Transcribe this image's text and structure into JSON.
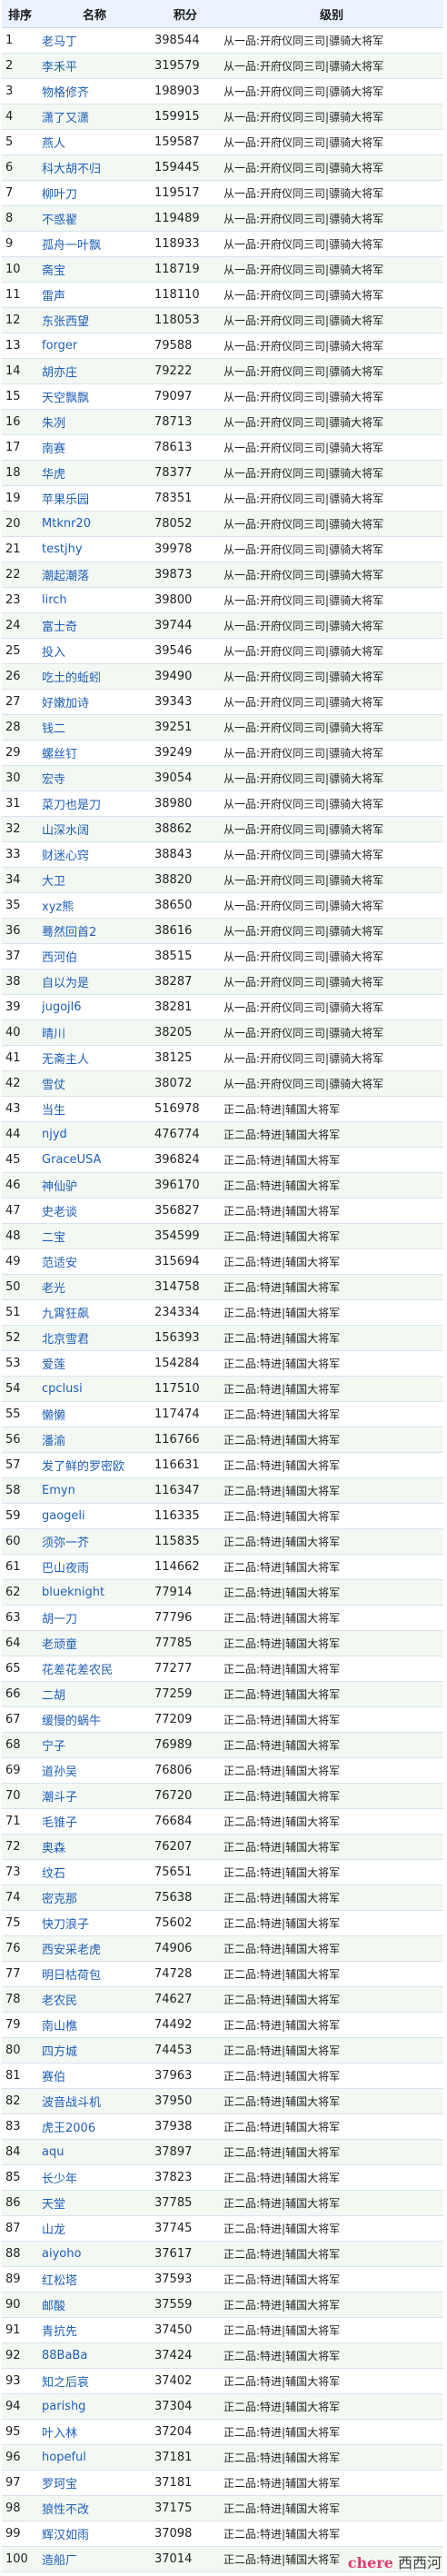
{
  "headers": {
    "rank": "排序",
    "name": "名称",
    "score": "积分",
    "level": "级别"
  },
  "level_texts": {
    "a": "从一品:开府仪同三司|骠骑大将军",
    "b": "正二品:特进|辅国大将军"
  },
  "rows": [
    {
      "rank": "1",
      "name": "老马丁",
      "score": "398544",
      "level": "从一品:开府仪同三司|骠骑大将军"
    },
    {
      "rank": "2",
      "name": "李禾平",
      "score": "319579",
      "level": "从一品:开府仪同三司|骠骑大将军"
    },
    {
      "rank": "3",
      "name": "物格修齐",
      "score": "198903",
      "level": "从一品:开府仪同三司|骠骑大将军"
    },
    {
      "rank": "4",
      "name": "潇了又潇",
      "score": "159915",
      "level": "从一品:开府仪同三司|骠骑大将军"
    },
    {
      "rank": "5",
      "name": "燕人",
      "score": "159587",
      "level": "从一品:开府仪同三司|骠骑大将军"
    },
    {
      "rank": "6",
      "name": "科大胡不归",
      "score": "159445",
      "level": "从一品:开府仪同三司|骠骑大将军"
    },
    {
      "rank": "7",
      "name": "柳叶刀",
      "score": "119517",
      "level": "从一品:开府仪同三司|骠骑大将军"
    },
    {
      "rank": "8",
      "name": "不惑翟",
      "score": "119489",
      "level": "从一品:开府仪同三司|骠骑大将军"
    },
    {
      "rank": "9",
      "name": "孤舟一叶飘",
      "score": "118933",
      "level": "从一品:开府仪同三司|骠骑大将军"
    },
    {
      "rank": "10",
      "name": "斋宝",
      "score": "118719",
      "level": "从一品:开府仪同三司|骠骑大将军"
    },
    {
      "rank": "11",
      "name": "雷声",
      "score": "118110",
      "level": "从一品:开府仪同三司|骠骑大将军"
    },
    {
      "rank": "12",
      "name": "东张西望",
      "score": "118053",
      "level": "从一品:开府仪同三司|骠骑大将军"
    },
    {
      "rank": "13",
      "name": "forger",
      "score": "79588",
      "level": "从一品:开府仪同三司|骠骑大将军"
    },
    {
      "rank": "14",
      "name": "胡亦庄",
      "score": "79222",
      "level": "从一品:开府仪同三司|骠骑大将军"
    },
    {
      "rank": "15",
      "name": "天空飘飘",
      "score": "79097",
      "level": "从一品:开府仪同三司|骠骑大将军"
    },
    {
      "rank": "16",
      "name": "朱冽",
      "score": "78713",
      "level": "从一品:开府仪同三司|骠骑大将军"
    },
    {
      "rank": "17",
      "name": "南赛",
      "score": "78613",
      "level": "从一品:开府仪同三司|骠骑大将军"
    },
    {
      "rank": "18",
      "name": "华虎",
      "score": "78377",
      "level": "从一品:开府仪同三司|骠骑大将军"
    },
    {
      "rank": "19",
      "name": "苹果乐园",
      "score": "78351",
      "level": "从一品:开府仪同三司|骠骑大将军"
    },
    {
      "rank": "20",
      "name": "Mtknr20",
      "score": "78052",
      "level": "从一品:开府仪同三司|骠骑大将军"
    },
    {
      "rank": "21",
      "name": "testjhy",
      "score": "39978",
      "level": "从一品:开府仪同三司|骠骑大将军"
    },
    {
      "rank": "22",
      "name": "潮起潮落",
      "score": "39873",
      "level": "从一品:开府仪同三司|骠骑大将军"
    },
    {
      "rank": "23",
      "name": "lirch",
      "score": "39800",
      "level": "从一品:开府仪同三司|骠骑大将军"
    },
    {
      "rank": "24",
      "name": "富士奇",
      "score": "39744",
      "level": "从一品:开府仪同三司|骠骑大将军"
    },
    {
      "rank": "25",
      "name": "投入",
      "score": "39546",
      "level": "从一品:开府仪同三司|骠骑大将军"
    },
    {
      "rank": "26",
      "name": "吃土的蚯蚓",
      "score": "39490",
      "level": "从一品:开府仪同三司|骠骑大将军"
    },
    {
      "rank": "27",
      "name": "好嫩加诗",
      "score": "39343",
      "level": "从一品:开府仪同三司|骠骑大将军"
    },
    {
      "rank": "28",
      "name": "钱二",
      "score": "39251",
      "level": "从一品:开府仪同三司|骠骑大将军"
    },
    {
      "rank": "29",
      "name": "螺丝钉",
      "score": "39249",
      "level": "从一品:开府仪同三司|骠骑大将军"
    },
    {
      "rank": "30",
      "name": "宏寺",
      "score": "39054",
      "level": "从一品:开府仪同三司|骠骑大将军"
    },
    {
      "rank": "31",
      "name": "菜刀也是刀",
      "score": "38980",
      "level": "从一品:开府仪同三司|骠骑大将军"
    },
    {
      "rank": "32",
      "name": "山深水阔",
      "score": "38862",
      "level": "从一品:开府仪同三司|骠骑大将军"
    },
    {
      "rank": "33",
      "name": "财迷心窍",
      "score": "38843",
      "level": "从一品:开府仪同三司|骠骑大将军"
    },
    {
      "rank": "34",
      "name": "大卫",
      "score": "38820",
      "level": "从一品:开府仪同三司|骠骑大将军"
    },
    {
      "rank": "35",
      "name": "xyz熊",
      "score": "38650",
      "level": "从一品:开府仪同三司|骠骑大将军"
    },
    {
      "rank": "36",
      "name": "蓦然回首2",
      "score": "38616",
      "level": "从一品:开府仪同三司|骠骑大将军"
    },
    {
      "rank": "37",
      "name": "西河伯",
      "score": "38515",
      "level": "从一品:开府仪同三司|骠骑大将军"
    },
    {
      "rank": "38",
      "name": "自以为是",
      "score": "38287",
      "level": "从一品:开府仪同三司|骠骑大将军"
    },
    {
      "rank": "39",
      "name": "jugojl6",
      "score": "38281",
      "level": "从一品:开府仪同三司|骠骑大将军"
    },
    {
      "rank": "40",
      "name": "晴川",
      "score": "38205",
      "level": "从一品:开府仪同三司|骠骑大将军"
    },
    {
      "rank": "41",
      "name": "无斋主人",
      "score": "38125",
      "level": "从一品:开府仪同三司|骠骑大将军"
    },
    {
      "rank": "42",
      "name": "雪仗",
      "score": "38072",
      "level": "从一品:开府仪同三司|骠骑大将军"
    },
    {
      "rank": "43",
      "name": "当生",
      "score": "516978",
      "level": "正二品:特进|辅国大将军"
    },
    {
      "rank": "44",
      "name": "njyd",
      "score": "476774",
      "level": "正二品:特进|辅国大将军"
    },
    {
      "rank": "45",
      "name": "GraceUSA",
      "score": "396824",
      "level": "正二品:特进|辅国大将军"
    },
    {
      "rank": "46",
      "name": "神仙驴",
      "score": "396170",
      "level": "正二品:特进|辅国大将军"
    },
    {
      "rank": "47",
      "name": "史老谈",
      "score": "356827",
      "level": "正二品:特进|辅国大将军"
    },
    {
      "rank": "48",
      "name": "二宝",
      "score": "354599",
      "level": "正二品:特进|辅国大将军"
    },
    {
      "rank": "49",
      "name": "范适安",
      "score": "315694",
      "level": "正二品:特进|辅国大将军"
    },
    {
      "rank": "50",
      "name": "老光",
      "score": "314758",
      "level": "正二品:特进|辅国大将军"
    },
    {
      "rank": "51",
      "name": "九霄狂飙",
      "score": "234334",
      "level": "正二品:特进|辅国大将军"
    },
    {
      "rank": "52",
      "name": "北京雪君",
      "score": "156393",
      "level": "正二品:特进|辅国大将军"
    },
    {
      "rank": "53",
      "name": "爱莲",
      "score": "154284",
      "level": "正二品:特进|辅国大将军"
    },
    {
      "rank": "54",
      "name": "cpclusi",
      "score": "117510",
      "level": "正二品:特进|辅国大将军"
    },
    {
      "rank": "55",
      "name": "懒懒",
      "score": "117474",
      "level": "正二品:特进|辅国大将军"
    },
    {
      "rank": "56",
      "name": "潘渝",
      "score": "116766",
      "level": "正二品:特进|辅国大将军"
    },
    {
      "rank": "57",
      "name": "发了鲜的罗密欧",
      "score": "116631",
      "level": "正二品:特进|辅国大将军"
    },
    {
      "rank": "58",
      "name": "Emyn",
      "score": "116347",
      "level": "正二品:特进|辅国大将军"
    },
    {
      "rank": "59",
      "name": "gaogeli",
      "score": "116335",
      "level": "正二品:特进|辅国大将军"
    },
    {
      "rank": "60",
      "name": "须弥一芥",
      "score": "115835",
      "level": "正二品:特进|辅国大将军"
    },
    {
      "rank": "61",
      "name": "巴山夜雨",
      "score": "114662",
      "level": "正二品:特进|辅国大将军"
    },
    {
      "rank": "62",
      "name": "blueknight",
      "score": "77914",
      "level": "正二品:特进|辅国大将军"
    },
    {
      "rank": "63",
      "name": "胡一刀",
      "score": "77796",
      "level": "正二品:特进|辅国大将军"
    },
    {
      "rank": "64",
      "name": "老顽童",
      "score": "77785",
      "level": "正二品:特进|辅国大将军"
    },
    {
      "rank": "65",
      "name": "花差花差农民",
      "score": "77277",
      "level": "正二品:特进|辅国大将军"
    },
    {
      "rank": "66",
      "name": "二胡",
      "score": "77259",
      "level": "正二品:特进|辅国大将军"
    },
    {
      "rank": "67",
      "name": "缓慢的蜗牛",
      "score": "77209",
      "level": "正二品:特进|辅国大将军"
    },
    {
      "rank": "68",
      "name": "宁子",
      "score": "76989",
      "level": "正二品:特进|辅国大将军"
    },
    {
      "rank": "69",
      "name": "道孙吴",
      "score": "76806",
      "level": "正二品:特进|辅国大将军"
    },
    {
      "rank": "70",
      "name": "潮斗子",
      "score": "76720",
      "level": "正二品:特进|辅国大将军"
    },
    {
      "rank": "71",
      "name": "毛锥子",
      "score": "76684",
      "level": "正二品:特进|辅国大将军"
    },
    {
      "rank": "72",
      "name": "奥森",
      "score": "76207",
      "level": "正二品:特进|辅国大将军"
    },
    {
      "rank": "73",
      "name": "纹石",
      "score": "75651",
      "level": "正二品:特进|辅国大将军"
    },
    {
      "rank": "74",
      "name": "密克那",
      "score": "75638",
      "level": "正二品:特进|辅国大将军"
    },
    {
      "rank": "75",
      "name": "快刀浪子",
      "score": "75602",
      "level": "正二品:特进|辅国大将军"
    },
    {
      "rank": "76",
      "name": "西安采老虎",
      "score": "74906",
      "level": "正二品:特进|辅国大将军"
    },
    {
      "rank": "77",
      "name": "明日枯荷包",
      "score": "74728",
      "level": "正二品:特进|辅国大将军"
    },
    {
      "rank": "78",
      "name": "老农民",
      "score": "74627",
      "level": "正二品:特进|辅国大将军"
    },
    {
      "rank": "79",
      "name": "南山樵",
      "score": "74492",
      "level": "正二品:特进|辅国大将军"
    },
    {
      "rank": "80",
      "name": "四方城",
      "score": "74453",
      "level": "正二品:特进|辅国大将军"
    },
    {
      "rank": "81",
      "name": "赛伯",
      "score": "37963",
      "level": "正二品:特进|辅国大将军"
    },
    {
      "rank": "82",
      "name": "波音战斗机",
      "score": "37950",
      "level": "正二品:特进|辅国大将军"
    },
    {
      "rank": "83",
      "name": "虎王2006",
      "score": "37938",
      "level": "正二品:特进|辅国大将军"
    },
    {
      "rank": "84",
      "name": "aqu",
      "score": "37897",
      "level": "正二品:特进|辅国大将军"
    },
    {
      "rank": "85",
      "name": "长少年",
      "score": "37823",
      "level": "正二品:特进|辅国大将军"
    },
    {
      "rank": "86",
      "name": "天堂",
      "score": "37785",
      "level": "正二品:特进|辅国大将军"
    },
    {
      "rank": "87",
      "name": "山龙",
      "score": "37745",
      "level": "正二品:特进|辅国大将军"
    },
    {
      "rank": "88",
      "name": "aiyoho",
      "score": "37617",
      "level": "正二品:特进|辅国大将军"
    },
    {
      "rank": "89",
      "name": "红松塔",
      "score": "37593",
      "level": "正二品:特进|辅国大将军"
    },
    {
      "rank": "90",
      "name": "邮酸",
      "score": "37559",
      "level": "正二品:特进|辅国大将军"
    },
    {
      "rank": "91",
      "name": "青抗先",
      "score": "37450",
      "level": "正二品:特进|辅国大将军"
    },
    {
      "rank": "92",
      "name": "88BaBa",
      "score": "37424",
      "level": "正二品:特进|辅国大将军"
    },
    {
      "rank": "93",
      "name": "知之后哀",
      "score": "37402",
      "level": "正二品:特进|辅国大将军"
    },
    {
      "rank": "94",
      "name": "parishg",
      "score": "37304",
      "level": "正二品:特进|辅国大将军"
    },
    {
      "rank": "95",
      "name": "叶入林",
      "score": "37204",
      "level": "正二品:特进|辅国大将军"
    },
    {
      "rank": "96",
      "name": "hopeful",
      "score": "37181",
      "level": "正二品:特进|辅国大将军"
    },
    {
      "rank": "97",
      "name": "罗珂宝",
      "score": "37181",
      "level": "正二品:特进|辅国大将军"
    },
    {
      "rank": "98",
      "name": "狼性不改",
      "score": "37175",
      "level": "正二品:特进|辅国大将军"
    },
    {
      "rank": "99",
      "name": "辉汉如雨",
      "score": "37098",
      "level": "正二品:特进|辅国大将军"
    },
    {
      "rank": "100",
      "name": "造船厂",
      "score": "37014",
      "level": "正二品:特进|辅国大将军"
    }
  ],
  "watermark": {
    "part_a": "chere",
    "part_b": "西西河"
  },
  "colors": {
    "header_bg": "#eaf3ff",
    "name_link": "#1f5fb8",
    "row_alt": "#f3f8f3",
    "watermark_accent": "#e23b6a"
  }
}
